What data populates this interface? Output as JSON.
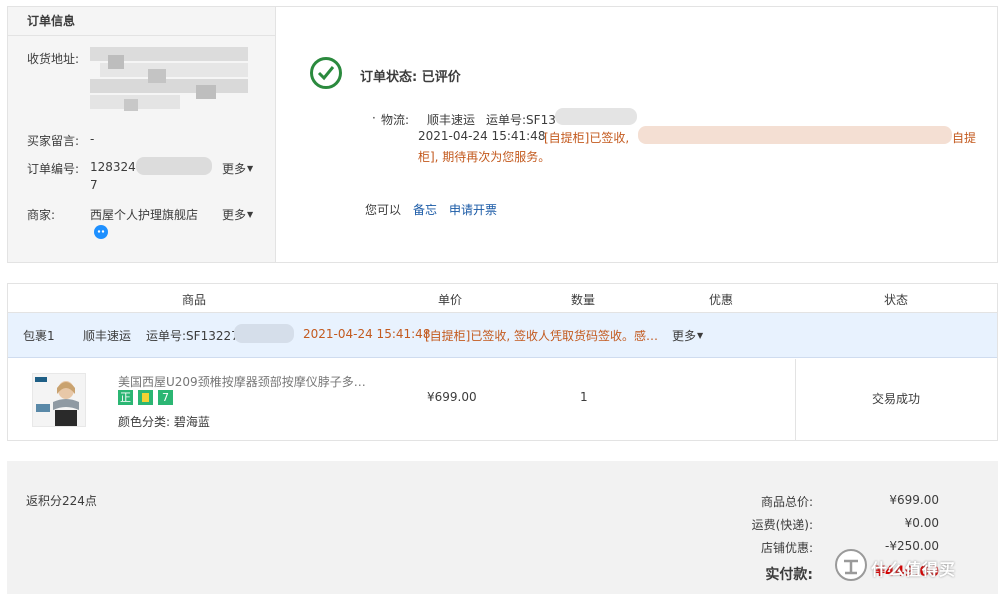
{
  "order_info": {
    "title": "订单信息",
    "address_label": "收货地址:",
    "message_label": "买家留言:",
    "message_value": "-",
    "order_no_label": "订单编号:",
    "order_no_value": "1283241",
    "order_no_value_line2": "7",
    "order_no_more": "更多",
    "seller_label": "商家:",
    "seller_value": "西屋个人护理旗舰店",
    "seller_more": "更多"
  },
  "status": {
    "text": "订单状态: 已评价",
    "logistics_dot": "·",
    "logistics_label": "物流:",
    "company": "顺丰速运",
    "waybill": "运单号:SF13",
    "time": "2021-04-24 15:41:48",
    "event": "[自提柜]已签收,",
    "event_tail": "自提",
    "event_line2": "柜], 期待再次为您服务。",
    "you_can": "您可以",
    "action_note": "备忘",
    "action_invoice": "申请开票"
  },
  "table": {
    "headers": [
      "商品",
      "单价",
      "数量",
      "优惠",
      "状态"
    ],
    "package": {
      "name": "包裹1",
      "company": "顺丰速运",
      "waybill": "运单号:SF13227",
      "time": "2021-04-24 15:41:48",
      "event": "[自提柜]已签收, 签收人凭取货码签收。感…",
      "more": "更多"
    },
    "item": {
      "title": "美国西屋U209颈椎按摩器颈部按摩仪脖子多…",
      "badges": [
        "正",
        "",
        "7"
      ],
      "attr": "颜色分类: 碧海蓝",
      "price": "¥699.00",
      "qty": "1",
      "status": "交易成功"
    }
  },
  "summary": {
    "points": "返积分224点",
    "goods_total_label": "商品总价:",
    "goods_total_value": "¥699.00",
    "shipping_label": "运费(快递):",
    "shipping_value": "¥0.00",
    "discount_label": "店铺优惠:",
    "discount_value": "-¥250.00",
    "paid_label": "实付款:",
    "paid_value": "¥449.00"
  },
  "watermark": {
    "text": "什么值得买"
  },
  "colors": {
    "orange": "#c35a1f",
    "link_blue": "#1a5aa6",
    "success_green": "#2b8a3e",
    "package_row_bg": "#e8f2fe",
    "total_red": "#d40000"
  }
}
